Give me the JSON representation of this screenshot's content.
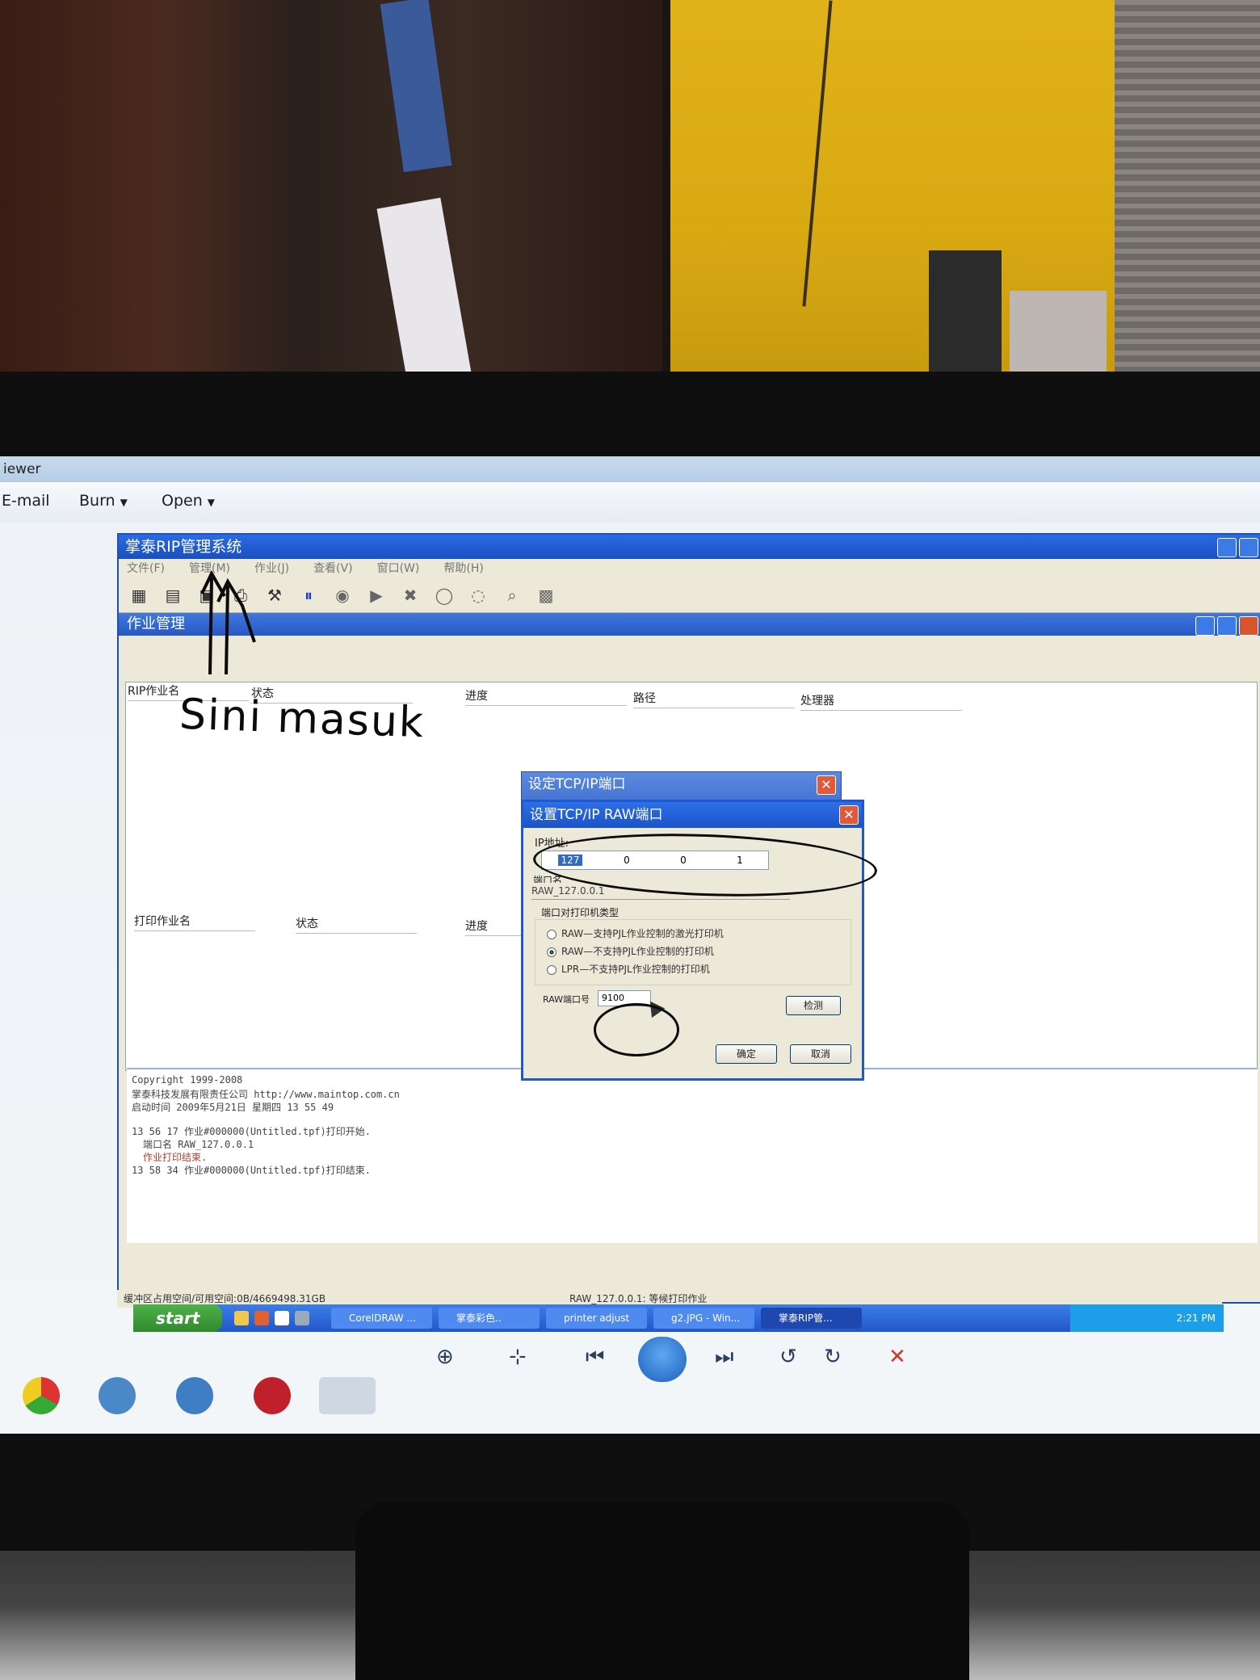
{
  "viewer": {
    "title": "iewer",
    "menu": {
      "email": "E-mail",
      "burn": "Burn",
      "open": "Open"
    }
  },
  "rip": {
    "title": "掌泰RIP管理系统",
    "menu": [
      "文件(F)",
      "管理(M)",
      "作业(J)",
      "查看(V)",
      "窗口(W)",
      "帮助(H)"
    ],
    "job_window_title": "作业管理",
    "rip_columns": [
      "RIP作业名",
      "状态",
      "进度",
      "路径",
      "处理器"
    ],
    "print_columns": [
      "打印作业名",
      "状态",
      "进度"
    ],
    "log": [
      "Copyright 1999-2008",
      "掌泰科技发展有限责任公司 http://www.maintop.com.cn",
      "启动时间  2009年5月21日 星期四 13 55 49",
      "13 56 17 作业#000000(Untitled.tpf)打印开始.",
      "端口名 RAW_127.0.0.1",
      "作业打印结束.",
      "13 58 34 作业#000000(Untitled.tpf)打印结束."
    ],
    "status_left": "缓冲区占用空间/可用空间:0B/4669498.31GB",
    "status_center": "RAW_127.0.0.1: 等候打印作业"
  },
  "dialog_back": {
    "title": "设定TCP/IP端口"
  },
  "dialog": {
    "title": "设置TCP/IP RAW端口",
    "ip_label": "IP地址:",
    "ip_octets": [
      "127",
      "0",
      "0",
      "1"
    ],
    "port_name_label": "端口名",
    "port_name_value": "RAW_127.0.0.1",
    "printer_type_label": "端口对打印机类型",
    "options": [
      "RAW—支持PJL作业控制的激光打印机",
      "RAW—不支持PJL作业控制的打印机",
      "LPR—不支持PJL作业控制的打印机"
    ],
    "selected_option": 1,
    "raw_port_label": "RAW端口号",
    "raw_port_value": "9100",
    "detect_button": "检测",
    "ok_button": "确定",
    "cancel_button": "取消"
  },
  "handwriting": "Sini masuk",
  "taskbar": {
    "start": "start",
    "tasks": [
      "CorelDRAW ...",
      "掌泰彩色..",
      "printer adjust",
      "g2.JPG - Win...",
      "掌泰RIP管..."
    ],
    "clock": "2:21 PM"
  }
}
